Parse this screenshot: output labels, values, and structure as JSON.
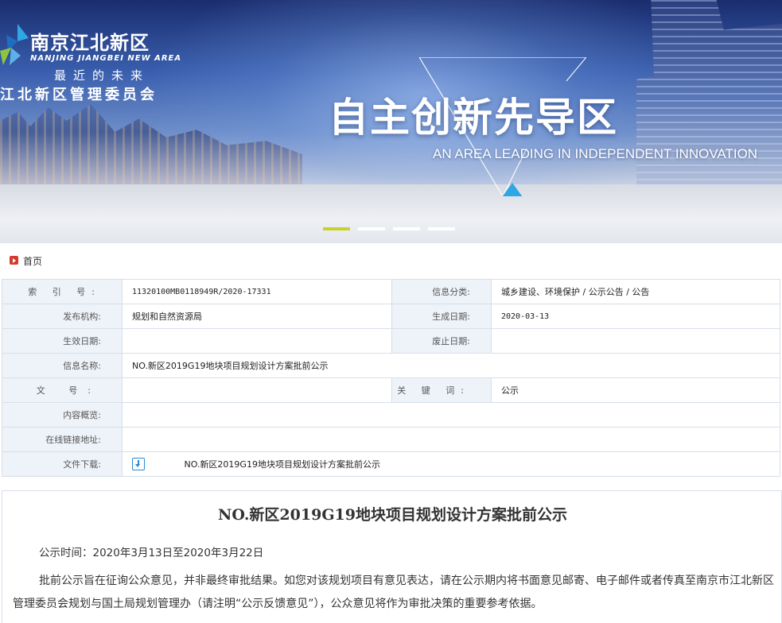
{
  "banner": {
    "logo_name": "南京江北新区",
    "logo_en": "NANJING JIANGBEI NEW AREA",
    "logo_slogan": "最近的未来",
    "logo_org": "江北新区管理委员会",
    "title": "自主创新先导区",
    "subtitle": "AN AREA LEADING IN INDEPENDENT INNOVATION",
    "slides_total": 4,
    "slide_active": 1,
    "colors": {
      "active_dot": "#c7d32b",
      "triangle_green": "#8cc63f",
      "triangle_yellow": "#c7d32b",
      "triangle_blue": "#2fa6e6"
    }
  },
  "breadcrumb": {
    "home_label": "首页"
  },
  "info": {
    "index_label": "索 引 号:",
    "index_value": "11320100MB0118949R/2020-17331",
    "category_label": "信息分类:",
    "category_value": "城乡建设、环境保护 / 公示公告 / 公告",
    "publisher_label": "发布机构:",
    "publisher_value": "规划和自然资源局",
    "created_label": "生成日期:",
    "created_value": "2020-03-13",
    "effective_label": "生效日期:",
    "effective_value": "",
    "expiry_label": "废止日期:",
    "expiry_value": "",
    "name_label": "信息名称:",
    "name_value": "NO.新区2019G19地块项目规划设计方案批前公示",
    "docno_label": "文 号:",
    "docno_value": "",
    "keyword_label": "关 键 词:",
    "keyword_value": "公示",
    "summary_label": "内容概览:",
    "summary_value": "",
    "link_label": "在线链接地址:",
    "link_value": "",
    "download_label": "文件下载:",
    "download_file": "NO.新区2019G19地块项目规划设计方案批前公示"
  },
  "article": {
    "title": "NO.新区2019G19地块项目规划设计方案批前公示",
    "time": "公示时间：2020年3月13日至2020年3月22日",
    "body": "批前公示旨在征询公众意见，并非最终审批结果。如您对该规划项目有意见表达，请在公示期内将书面意见邮寄、电子邮件或者传真至南京市江北新区管理委员会规划与国土局规划管理办（请注明“公示反馈意见”），公众意见将作为审批决策的重要参考依据。"
  }
}
